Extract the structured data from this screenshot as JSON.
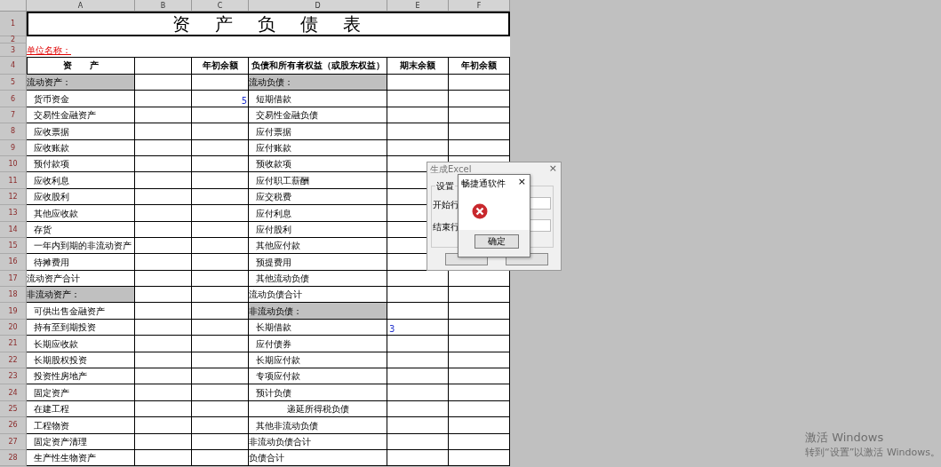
{
  "columns": [
    "A",
    "B",
    "C",
    "D",
    "E",
    "F"
  ],
  "top_rows": [
    "1",
    "2",
    "3",
    "4"
  ],
  "title": "资　产　负　债　表",
  "unit_label": "单位名称：",
  "header": {
    "col_a": "资　　产",
    "col_c": "年初余额",
    "col_d": "负债和所有者权益（或股东权益）",
    "col_e": "期末余额",
    "col_f": "年初余额"
  },
  "rows": [
    {
      "number": "5",
      "left": {
        "text": "流动资产：",
        "kind": "section"
      },
      "right": {
        "text": "流动负债：",
        "kind": "section"
      }
    },
    {
      "number": "6",
      "left": {
        "text": "货币资金",
        "kind": "item"
      },
      "c": "5",
      "right": {
        "text": "短期借款",
        "kind": "item"
      }
    },
    {
      "number": "7",
      "left": {
        "text": "交易性金融资产",
        "kind": "item"
      },
      "right": {
        "text": "交易性金融负债",
        "kind": "item"
      }
    },
    {
      "number": "8",
      "left": {
        "text": "应收票据",
        "kind": "item"
      },
      "right": {
        "text": "应付票据",
        "kind": "item"
      }
    },
    {
      "number": "9",
      "left": {
        "text": "应收账款",
        "kind": "item"
      },
      "right": {
        "text": "应付账款",
        "kind": "item"
      }
    },
    {
      "number": "10",
      "left": {
        "text": "预付款项",
        "kind": "item"
      },
      "right": {
        "text": "预收款项",
        "kind": "item"
      }
    },
    {
      "number": "11",
      "left": {
        "text": "应收利息",
        "kind": "item"
      },
      "right": {
        "text": "应付职工薪酬",
        "kind": "item"
      }
    },
    {
      "number": "12",
      "left": {
        "text": "应收股利",
        "kind": "item"
      },
      "right": {
        "text": "应交税费",
        "kind": "item"
      }
    },
    {
      "number": "13",
      "left": {
        "text": "其他应收款",
        "kind": "item"
      },
      "right": {
        "text": "应付利息",
        "kind": "item"
      }
    },
    {
      "number": "14",
      "left": {
        "text": "存货",
        "kind": "item"
      },
      "right": {
        "text": "应付股利",
        "kind": "item"
      }
    },
    {
      "number": "15",
      "left": {
        "text": "一年内到期的非流动资产",
        "kind": "item"
      },
      "right": {
        "text": "其他应付款",
        "kind": "item"
      }
    },
    {
      "number": "16",
      "left": {
        "text": "待摊费用",
        "kind": "item"
      },
      "right": {
        "text": "预提费用",
        "kind": "item"
      }
    },
    {
      "number": "17",
      "left": {
        "text": "流动资产合计",
        "kind": "total"
      },
      "right": {
        "text": "其他流动负债",
        "kind": "item"
      }
    },
    {
      "number": "18",
      "left": {
        "text": "非流动资产：",
        "kind": "section"
      },
      "right": {
        "text": "流动负债合计",
        "kind": "total"
      }
    },
    {
      "number": "19",
      "left": {
        "text": "可供出售金融资产",
        "kind": "item"
      },
      "right": {
        "text": "非流动负债：",
        "kind": "section"
      }
    },
    {
      "number": "20",
      "left": {
        "text": "持有至到期投资",
        "kind": "item"
      },
      "right": {
        "text": "长期借款",
        "kind": "item"
      },
      "e": "3"
    },
    {
      "number": "21",
      "left": {
        "text": "长期应收款",
        "kind": "item"
      },
      "right": {
        "text": "应付债券",
        "kind": "item"
      }
    },
    {
      "number": "22",
      "left": {
        "text": "长期股权投资",
        "kind": "item"
      },
      "right": {
        "text": "长期应付款",
        "kind": "item"
      }
    },
    {
      "number": "23",
      "left": {
        "text": "投资性房地产",
        "kind": "item"
      },
      "right": {
        "text": "专项应付款",
        "kind": "item"
      }
    },
    {
      "number": "24",
      "left": {
        "text": "固定资产",
        "kind": "item"
      },
      "right": {
        "text": "预计负债",
        "kind": "item"
      }
    },
    {
      "number": "25",
      "left": {
        "text": "在建工程",
        "kind": "item"
      },
      "right": {
        "text": "递延所得税负债",
        "kind": "centered"
      }
    },
    {
      "number": "26",
      "left": {
        "text": "工程物资",
        "kind": "item"
      },
      "right": {
        "text": "其他非流动负债",
        "kind": "item"
      }
    },
    {
      "number": "27",
      "left": {
        "text": "固定资产清理",
        "kind": "item"
      },
      "right": {
        "text": "非流动负债合计",
        "kind": "total"
      }
    },
    {
      "number": "28",
      "left": {
        "text": "生产性生物资产",
        "kind": "item"
      },
      "right": {
        "text": "负债合计",
        "kind": "total"
      }
    }
  ],
  "dialog": {
    "title": "生成Excel",
    "close": "×",
    "group": "设置",
    "fields": [
      "开始行",
      "结束行"
    ]
  },
  "alert": {
    "title": "畅捷通软件",
    "close": "×",
    "button": "确定"
  },
  "watermark": {
    "title": "激活 Windows",
    "subtitle": "转到“设置”以激活 Windows。"
  }
}
